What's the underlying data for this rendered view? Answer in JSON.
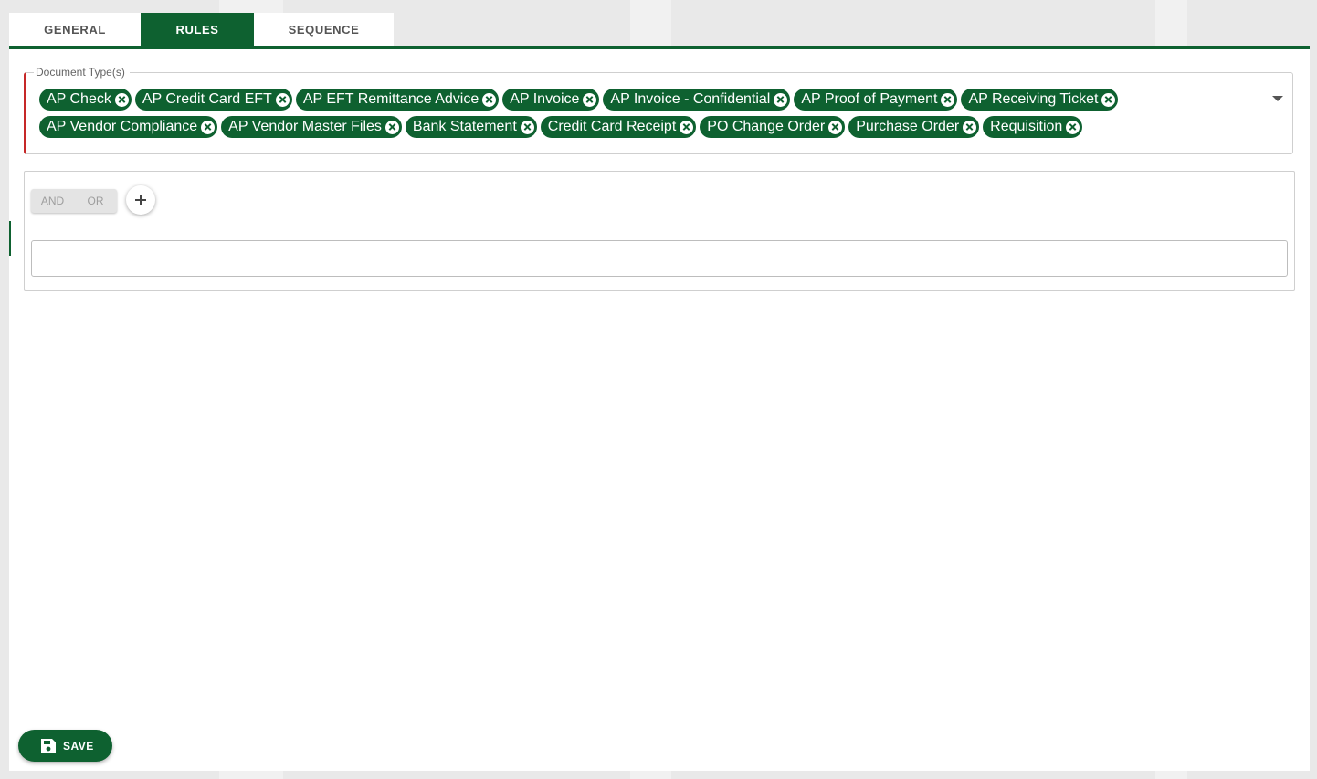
{
  "tabs": [
    {
      "label": "GENERAL",
      "active": false
    },
    {
      "label": "RULES",
      "active": true
    },
    {
      "label": "SEQUENCE",
      "active": false
    }
  ],
  "document_types": {
    "legend": "Document Type(s)",
    "selected": [
      "AP Check",
      "AP Credit Card EFT",
      "AP EFT Remittance Advice",
      "AP Invoice",
      "AP Invoice - Confidential",
      "AP Proof of Payment",
      "AP Receiving Ticket",
      "AP Vendor Compliance",
      "AP Vendor Master Files",
      "Bank Statement",
      "Credit Card Receipt",
      "PO Change Order",
      "Purchase Order",
      "Requisition"
    ]
  },
  "rule_builder": {
    "and_label": "AND",
    "or_label": "OR",
    "add_icon": "plus-icon",
    "input_value": ""
  },
  "save_button": {
    "label": "SAVE",
    "icon": "floppy-disk-icon"
  },
  "colors": {
    "accent": "#0e6130",
    "error": "#c62828"
  }
}
